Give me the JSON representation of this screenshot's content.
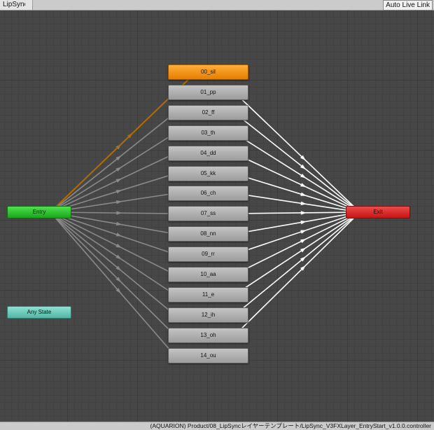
{
  "toolbar": {
    "layer_name": "LipSync",
    "live_link_label": "Auto Live Link"
  },
  "entry": {
    "label": "Entry"
  },
  "exit": {
    "label": "Exit"
  },
  "any_state": {
    "label": "Any State"
  },
  "states": [
    {
      "label": "00_sil",
      "is_default": true
    },
    {
      "label": "01_pp",
      "is_default": false
    },
    {
      "label": "02_ff",
      "is_default": false
    },
    {
      "label": "03_th",
      "is_default": false
    },
    {
      "label": "04_dd",
      "is_default": false
    },
    {
      "label": "05_kk",
      "is_default": false
    },
    {
      "label": "06_ch",
      "is_default": false
    },
    {
      "label": "07_ss",
      "is_default": false
    },
    {
      "label": "08_nn",
      "is_default": false
    },
    {
      "label": "09_rr",
      "is_default": false
    },
    {
      "label": "10_aa",
      "is_default": false
    },
    {
      "label": "11_e",
      "is_default": false
    },
    {
      "label": "12_ih",
      "is_default": false
    },
    {
      "label": "13_oh",
      "is_default": false
    },
    {
      "label": "14_ou",
      "is_default": false
    }
  ],
  "status": {
    "path": "(AQUARION) Product/08_LipSyncレイヤーテンプレート/LipSync_V3FXLayer_EntryStart_v1.0.0.controller"
  },
  "colors": {
    "default_state": "#f39300",
    "entry": "#2ecc2e",
    "exit": "#e02020",
    "any_state": "#6fcfbf",
    "default_transition": "#b36b00",
    "entry_transition": "#8a8a8a",
    "exit_transition": "#ffffff"
  }
}
